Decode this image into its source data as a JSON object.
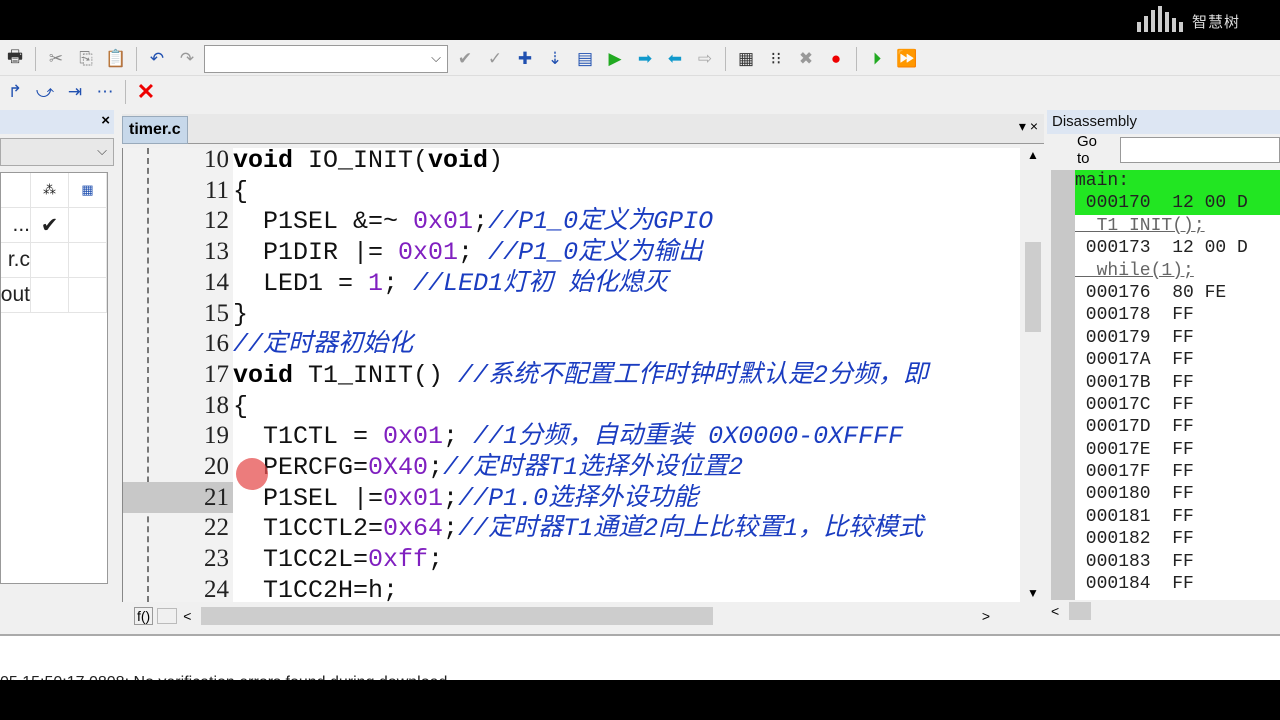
{
  "watermark": {
    "logo_text": "智慧树"
  },
  "toolbar": {
    "row1_icons": [
      "print-icon",
      "cut-icon",
      "copy-icon",
      "paste-icon",
      "undo-icon",
      "redo-icon"
    ],
    "find_combo_value": "",
    "row1_right_icons": [
      "bookmark-icon",
      "bookmark-prev-icon",
      "bookmark-add-icon",
      "bookmark-clear-icon",
      "build-icon",
      "step-icon",
      "step-over-icon",
      "step-out-icon",
      "run-to-cursor-icon",
      "disasm-icon",
      "mem-icon",
      "clear-icon",
      "breakpoint-icon",
      "go-icon",
      "go-next-icon"
    ],
    "row2_icons": [
      "step-into-icon",
      "step-over-icon",
      "run-to-icon",
      "step-all-icon",
      "stop-icon"
    ]
  },
  "workspace": {
    "rows": [
      {
        "name": "...",
        "check": "✔"
      },
      {
        "name": "r.c",
        "check": ""
      },
      {
        "name": "out",
        "check": ""
      }
    ]
  },
  "editor": {
    "tab": "timer.c",
    "hscroll_label": "f()",
    "lines": [
      {
        "n": "10",
        "tokens": [
          {
            "c": "kw",
            "t": "void"
          },
          {
            "c": "pl",
            "t": " IO_INIT("
          },
          {
            "c": "kw",
            "t": "void"
          },
          {
            "c": "pl",
            "t": ")"
          }
        ]
      },
      {
        "n": "11",
        "tokens": [
          {
            "c": "pl",
            "t": "{"
          }
        ]
      },
      {
        "n": "12",
        "tokens": [
          {
            "c": "pl",
            "t": "  P1SEL &=~ "
          },
          {
            "c": "num",
            "t": "0x01"
          },
          {
            "c": "pl",
            "t": ";"
          },
          {
            "c": "cm",
            "t": "//P1_0定义为GPIO"
          }
        ]
      },
      {
        "n": "13",
        "tokens": [
          {
            "c": "pl",
            "t": "  P1DIR |= "
          },
          {
            "c": "num",
            "t": "0x01"
          },
          {
            "c": "pl",
            "t": "; "
          },
          {
            "c": "cm",
            "t": "//P1_0定义为输出"
          }
        ]
      },
      {
        "n": "14",
        "tokens": [
          {
            "c": "pl",
            "t": "  LED1 = "
          },
          {
            "c": "num",
            "t": "1"
          },
          {
            "c": "pl",
            "t": "; "
          },
          {
            "c": "cm",
            "t": "//LED1灯初 始化熄灭"
          }
        ]
      },
      {
        "n": "15",
        "tokens": [
          {
            "c": "pl",
            "t": "}"
          }
        ]
      },
      {
        "n": "16",
        "tokens": [
          {
            "c": "cm",
            "t": "//定时器初始化"
          }
        ]
      },
      {
        "n": "17",
        "tokens": [
          {
            "c": "kw",
            "t": "void"
          },
          {
            "c": "pl",
            "t": " T1_INIT() "
          },
          {
            "c": "cm",
            "t": "//系统不配置工作时钟时默认是2分频，即"
          }
        ]
      },
      {
        "n": "18",
        "tokens": [
          {
            "c": "pl",
            "t": "{"
          }
        ]
      },
      {
        "n": "19",
        "tokens": [
          {
            "c": "pl",
            "t": "  T1CTL = "
          },
          {
            "c": "num",
            "t": "0x01"
          },
          {
            "c": "pl",
            "t": "; "
          },
          {
            "c": "cm",
            "t": "//1分频，自动重装 0X0000-0XFFFF"
          }
        ]
      },
      {
        "n": "20",
        "tokens": [
          {
            "c": "pl",
            "t": "  PERCFG="
          },
          {
            "c": "num",
            "t": "0X40"
          },
          {
            "c": "pl",
            "t": ";"
          },
          {
            "c": "cm",
            "t": "//定时器T1选择外设位置2"
          }
        ]
      },
      {
        "n": "21",
        "tokens": [
          {
            "c": "pl",
            "t": "  P1SEL |="
          },
          {
            "c": "num",
            "t": "0x01"
          },
          {
            "c": "pl",
            "t": ";"
          },
          {
            "c": "cm",
            "t": "//P1.0选择外设功能"
          }
        ]
      },
      {
        "n": "22",
        "tokens": [
          {
            "c": "pl",
            "t": "  T1CCTL2="
          },
          {
            "c": "num",
            "t": "0x64"
          },
          {
            "c": "pl",
            "t": ";"
          },
          {
            "c": "cm",
            "t": "//定时器T1通道2向上比较置1，比较模式"
          }
        ]
      },
      {
        "n": "23",
        "tokens": [
          {
            "c": "pl",
            "t": "  T1CC2L="
          },
          {
            "c": "num",
            "t": "0xff"
          },
          {
            "c": "pl",
            "t": ";"
          }
        ]
      },
      {
        "n": "24",
        "tokens": [
          {
            "c": "pl",
            "t": "  T1CC2H=h;"
          }
        ]
      }
    ],
    "current_line": "21"
  },
  "disassembly": {
    "title": "Disassembly",
    "goto_label": "Go to",
    "goto_value": "",
    "lines": [
      {
        "t": "main:",
        "k": "hl"
      },
      {
        "t": " 000170  12 00 D",
        "k": "hl"
      },
      {
        "t": "  T1_INIT();",
        "k": "src"
      },
      {
        "t": " 000173  12 00 D",
        "k": ""
      },
      {
        "t": "  while(1);",
        "k": "src"
      },
      {
        "t": " 000176  80 FE",
        "k": ""
      },
      {
        "t": " 000178  FF",
        "k": ""
      },
      {
        "t": " 000179  FF",
        "k": ""
      },
      {
        "t": " 00017A  FF",
        "k": ""
      },
      {
        "t": " 00017B  FF",
        "k": ""
      },
      {
        "t": " 00017C  FF",
        "k": ""
      },
      {
        "t": " 00017D  FF",
        "k": ""
      },
      {
        "t": " 00017E  FF",
        "k": ""
      },
      {
        "t": " 00017F  FF",
        "k": ""
      },
      {
        "t": " 000180  FF",
        "k": ""
      },
      {
        "t": " 000181  FF",
        "k": ""
      },
      {
        "t": " 000182  FF",
        "k": ""
      },
      {
        "t": " 000183  FF",
        "k": ""
      },
      {
        "t": " 000184  FF",
        "k": ""
      }
    ]
  },
  "output": {
    "text": "05 15:50:17 0808: No verification errors found during download"
  }
}
